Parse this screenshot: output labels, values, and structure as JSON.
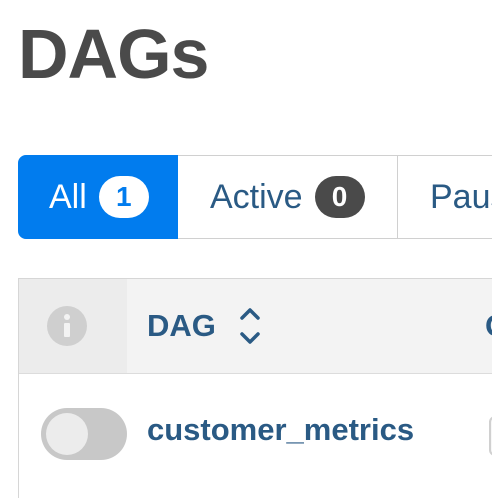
{
  "header": {
    "title": "DAGs"
  },
  "tabs": [
    {
      "label": "All",
      "count": "1"
    },
    {
      "label": "Active",
      "count": "0"
    },
    {
      "label": "Paus"
    }
  ],
  "table": {
    "columns": {
      "info_icon": "info-icon",
      "dag": "DAG",
      "next": "O",
      "sort_icon": "sort-icon"
    },
    "rows": [
      {
        "toggle_state": "off",
        "dag_id": "customer_metrics"
      }
    ]
  },
  "colors": {
    "accent": "#017cee",
    "title": "#4a4a4a",
    "link": "#2a5a84",
    "badge_dark": "#4a4a4a",
    "toggle_off": "#c8c8c8",
    "header_bg": "#f3f3f3"
  }
}
